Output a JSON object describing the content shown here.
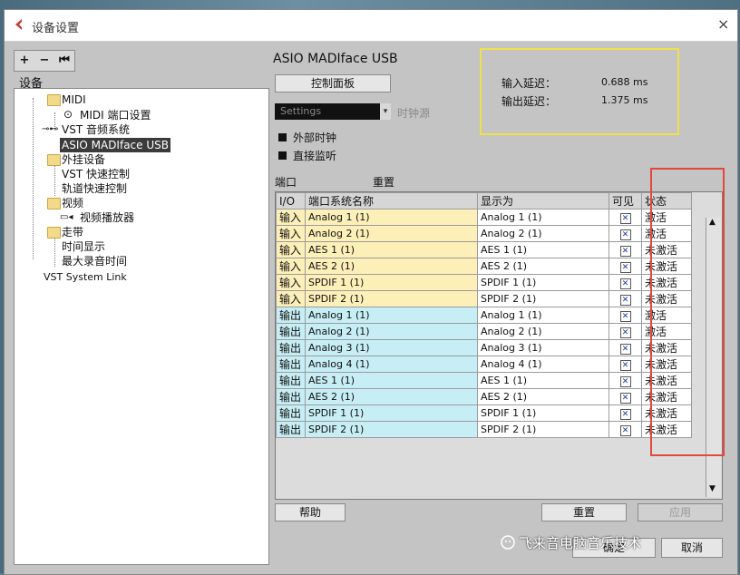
{
  "window": {
    "title": "设备设置",
    "close_icon": "×"
  },
  "toolbar": {
    "add": "+",
    "remove": "−",
    "reset": "⏮"
  },
  "devices_label": "设备",
  "tree": {
    "midi": "MIDI",
    "midi_port": "MIDI 端口设置",
    "vst_audio": "VST 音频系统",
    "asio": "ASIO MADIface USB",
    "external": "外挂设备",
    "vst_quick": "VST 快速控制",
    "track_quick": "轨道快速控制",
    "video": "视频",
    "video_player": "视频播放器",
    "transport": "走带",
    "time_display": "时间显示",
    "max_rec_time": "最大录音时间",
    "vst_link": "VST System Link"
  },
  "panel": {
    "device_name": "ASIO MADIface USB",
    "control_panel": "控制面板",
    "clock_select": "Settings",
    "clock_source": "时钟源",
    "external_clock": "外部时钟",
    "direct_monitor": "直接监听",
    "ports_label": "端口",
    "reset_label": "重置"
  },
  "latency": {
    "input_label": "输入延迟：",
    "input_value": "0.688 ms",
    "output_label": "输出延迟：",
    "output_value": "1.375 ms"
  },
  "table": {
    "headers": [
      "I/O",
      "端口系统名称",
      "显示为",
      "可见",
      "状态"
    ],
    "rows": [
      {
        "io": "输入",
        "name": "Analog 1 (1)",
        "display": "Analog 1 (1)",
        "visible": "✕",
        "status": "激活",
        "kind": "in"
      },
      {
        "io": "输入",
        "name": "Analog 2 (1)",
        "display": "Analog 2 (1)",
        "visible": "✕",
        "status": "激活",
        "kind": "in"
      },
      {
        "io": "输入",
        "name": "AES 1 (1)",
        "display": "AES 1 (1)",
        "visible": "✕",
        "status": "未激活",
        "kind": "in"
      },
      {
        "io": "输入",
        "name": "AES 2 (1)",
        "display": "AES 2 (1)",
        "visible": "✕",
        "status": "未激活",
        "kind": "in"
      },
      {
        "io": "输入",
        "name": "SPDIF 1 (1)",
        "display": "SPDIF 1 (1)",
        "visible": "✕",
        "status": "未激活",
        "kind": "in"
      },
      {
        "io": "输入",
        "name": "SPDIF 2 (1)",
        "display": "SPDIF 2 (1)",
        "visible": "✕",
        "status": "未激活",
        "kind": "in"
      },
      {
        "io": "输出",
        "name": "Analog 1 (1)",
        "display": "Analog 1 (1)",
        "visible": "✕",
        "status": "激活",
        "kind": "out"
      },
      {
        "io": "输出",
        "name": "Analog 2 (1)",
        "display": "Analog 2 (1)",
        "visible": "✕",
        "status": "激活",
        "kind": "out"
      },
      {
        "io": "输出",
        "name": "Analog 3 (1)",
        "display": "Analog 3 (1)",
        "visible": "✕",
        "status": "未激活",
        "kind": "out"
      },
      {
        "io": "输出",
        "name": "Analog 4 (1)",
        "display": "Analog 4 (1)",
        "visible": "✕",
        "status": "未激活",
        "kind": "out"
      },
      {
        "io": "输出",
        "name": "AES 1 (1)",
        "display": "AES 1 (1)",
        "visible": "✕",
        "status": "未激活",
        "kind": "out"
      },
      {
        "io": "输出",
        "name": "AES 2 (1)",
        "display": "AES 2 (1)",
        "visible": "✕",
        "status": "未激活",
        "kind": "out"
      },
      {
        "io": "输出",
        "name": "SPDIF 1 (1)",
        "display": "SPDIF 1 (1)",
        "visible": "✕",
        "status": "未激活",
        "kind": "out"
      },
      {
        "io": "输出",
        "name": "SPDIF 2 (1)",
        "display": "SPDIF 2 (1)",
        "visible": "✕",
        "status": "未激活",
        "kind": "out"
      }
    ]
  },
  "footer": {
    "help": "帮助",
    "reset": "重置",
    "apply": "应用",
    "ok": "确定",
    "cancel": "取消"
  },
  "watermark": "飞来音电脑音乐技术",
  "colors": {
    "input_row": "#fcefb8",
    "output_row": "#c7eef4",
    "latency_box": "#f0e04a",
    "highlight_box": "#e04a3a"
  }
}
